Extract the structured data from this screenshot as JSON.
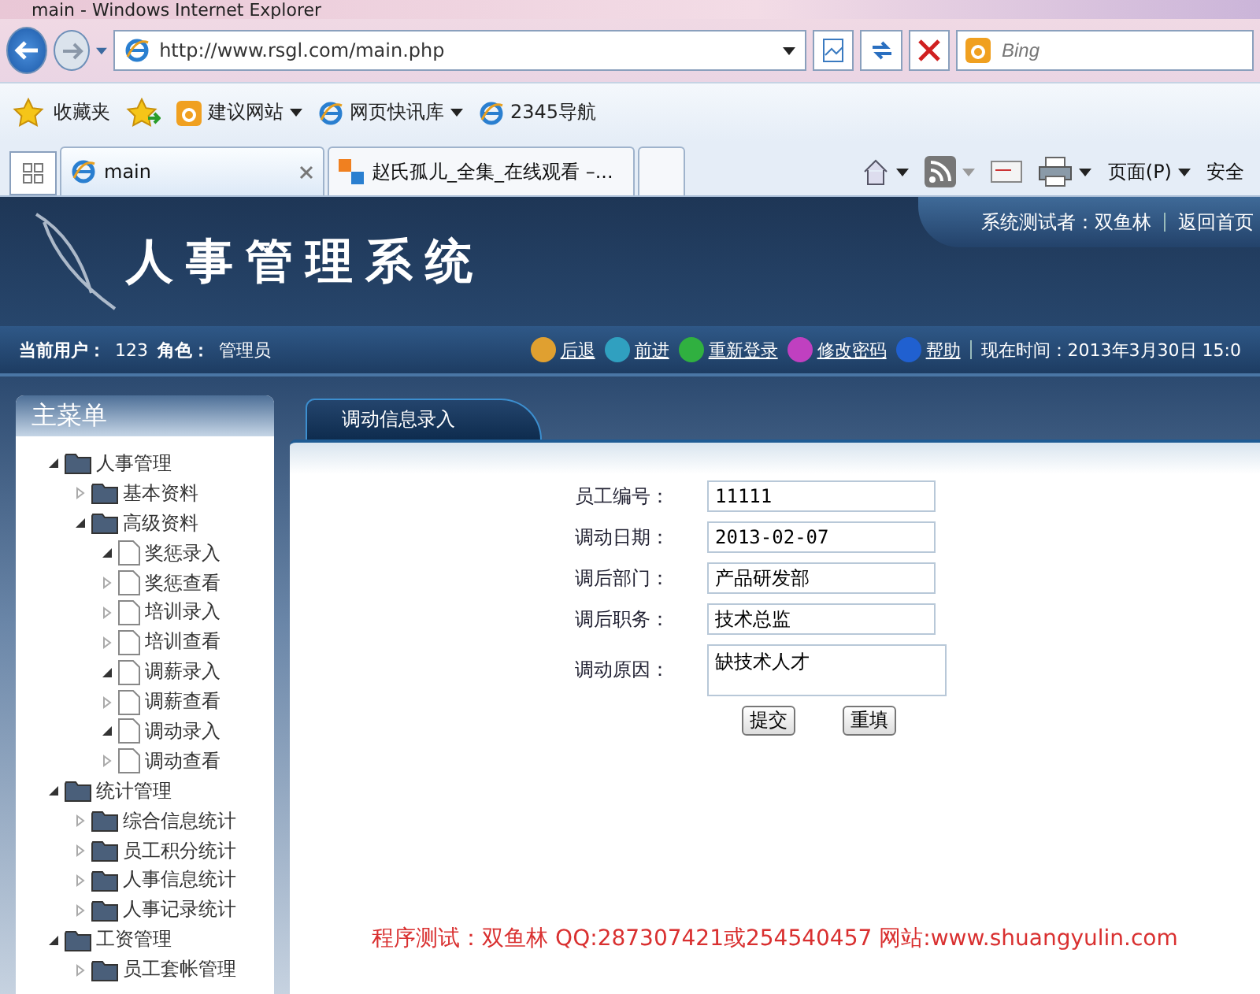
{
  "window": {
    "title": "main - Windows Internet Explorer"
  },
  "address_bar": {
    "url": "http://www.rsgl.com/main.php"
  },
  "search": {
    "placeholder": "Bing"
  },
  "favorites_bar": [
    {
      "label": "收藏夹",
      "kind": "star"
    },
    {
      "label": "建议网站",
      "kind": "bing",
      "menu": true
    },
    {
      "label": "网页快讯库",
      "kind": "ie",
      "menu": true
    },
    {
      "label": "2345导航",
      "kind": "ie",
      "menu": false
    }
  ],
  "tabs": [
    {
      "label": "main",
      "selected": true,
      "kind": "ie"
    },
    {
      "label": "赵氏孤儿_全集_在线观看 –...",
      "selected": false,
      "kind": "soku"
    }
  ],
  "command_bar": {
    "page_menu": "页面(P)",
    "safety_menu": "安全"
  },
  "app": {
    "title": "人事管理系统",
    "tester": "系统测试者：双鱼林",
    "home_link": "返回首页"
  },
  "user_bar": {
    "user_label": "当前用户：",
    "user": "123",
    "role_label": "角色：",
    "role": "管理员",
    "links": [
      {
        "label": "后退",
        "color": "#e0a030"
      },
      {
        "label": "前进",
        "color": "#30a0c0"
      },
      {
        "label": "重新登录",
        "color": "#30b040"
      },
      {
        "label": "修改密码",
        "color": "#c040c0"
      },
      {
        "label": "帮助",
        "color": "#2060d0"
      }
    ],
    "time": "现在时间：2013年3月30日 15:0"
  },
  "sidebar": {
    "title": "主菜单",
    "items": [
      {
        "label": "人事管理",
        "kind": "folder",
        "expanded": true,
        "children": [
          {
            "label": "基本资料",
            "kind": "folder",
            "expanded": false
          },
          {
            "label": "高级资料",
            "kind": "folder",
            "expanded": true,
            "children": [
              {
                "label": "奖惩录入",
                "kind": "file",
                "expanded": true
              },
              {
                "label": "奖惩查看",
                "kind": "file",
                "expanded": false
              },
              {
                "label": "培训录入",
                "kind": "file",
                "expanded": false
              },
              {
                "label": "培训查看",
                "kind": "file",
                "expanded": false
              },
              {
                "label": "调薪录入",
                "kind": "file",
                "expanded": true
              },
              {
                "label": "调薪查看",
                "kind": "file",
                "expanded": false
              },
              {
                "label": "调动录入",
                "kind": "file",
                "expanded": true
              },
              {
                "label": "调动查看",
                "kind": "file",
                "expanded": false
              }
            ]
          }
        ]
      },
      {
        "label": "统计管理",
        "kind": "folder",
        "expanded": true,
        "children": [
          {
            "label": "综合信息统计",
            "kind": "folder",
            "expanded": false
          },
          {
            "label": "员工积分统计",
            "kind": "folder",
            "expanded": false
          },
          {
            "label": "人事信息统计",
            "kind": "folder",
            "expanded": false
          },
          {
            "label": "人事记录统计",
            "kind": "folder",
            "expanded": false
          }
        ]
      },
      {
        "label": "工资管理",
        "kind": "folder",
        "expanded": true,
        "children": [
          {
            "label": "员工套帐管理",
            "kind": "folder",
            "expanded": false
          }
        ]
      }
    ]
  },
  "content": {
    "tab": "调动信息录入",
    "fields": [
      {
        "label": "员工编号：",
        "value": "11111",
        "kind": "input"
      },
      {
        "label": "调动日期：",
        "value": "2013-02-07",
        "kind": "input"
      },
      {
        "label": "调后部门：",
        "value": "产品研发部",
        "kind": "input"
      },
      {
        "label": "调后职务：",
        "value": "技术总监",
        "kind": "input"
      },
      {
        "label": "调动原因：",
        "value": "缺技术人才",
        "kind": "textarea"
      }
    ],
    "buttons": [
      "提交",
      "重填"
    ],
    "footer": "程序测试：双鱼林 QQ:287307421或254540457 网站:www.shuangyulin.com"
  }
}
